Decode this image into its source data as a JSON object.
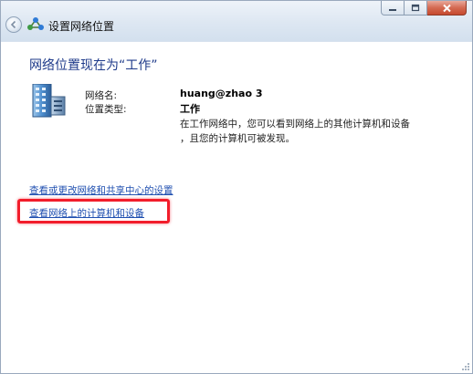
{
  "window": {
    "title": "设置网络位置"
  },
  "heading": "网络位置现在为“工作”",
  "network": {
    "name_label": "网络名:",
    "name_value": "huang@zhao  3",
    "type_label": "位置类型:",
    "type_value": "工作",
    "description_line1": "在工作网络中，您可以看到网络上的其他计算机和设备",
    "description_line2": "，且您的计算机可被发现。"
  },
  "links": {
    "sharing_center": "查看或更改网络和共享中心的设置",
    "view_computers": "查看网络上的计算机和设备"
  },
  "colors": {
    "heading": "#1e3a8a",
    "link": "#1f4fb0",
    "highlight": "#f21d2b",
    "close_button": "#c64a2f"
  },
  "icons": {
    "back": "back-arrow-icon",
    "title": "network-icon",
    "network_location": "work-network-icon"
  }
}
